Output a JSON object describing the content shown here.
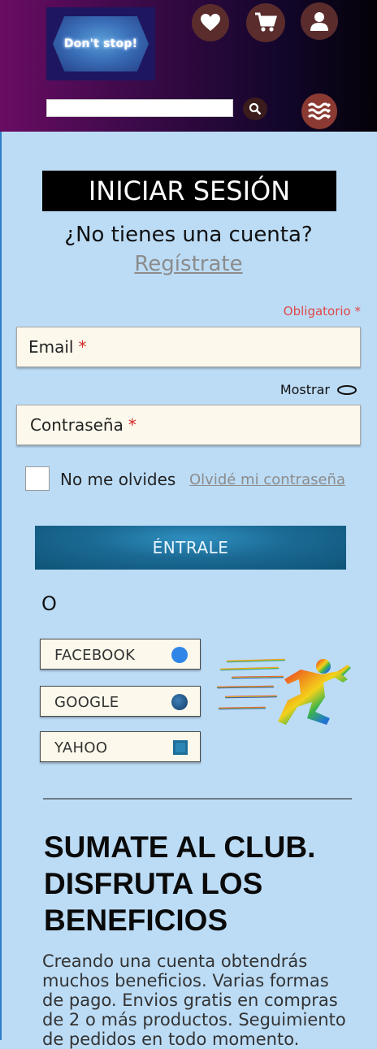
{
  "header": {
    "logo_text": "Don't stop!",
    "icons": [
      "heart-icon",
      "cart-icon",
      "user-icon"
    ],
    "search": {
      "value": "",
      "placeholder": ""
    },
    "search_icon": "search-icon",
    "menu_icon": "menu-icon"
  },
  "login": {
    "title": "INICIAR SESIÓN",
    "no_account": "¿No tienes una cuenta?",
    "register_link": "Regístrate",
    "required_note": "Obligatorio *",
    "email_label": "Email",
    "password_label": "Contraseña",
    "required_star": "*",
    "show_label": "Mostrar",
    "remember_label": "No me olvides",
    "forgot_link": "Olvidé mi contraseña",
    "submit_label": "ÉNTRALE",
    "or_text": "O"
  },
  "social": [
    {
      "label": "FACEBOOK",
      "icon": "circle-icon"
    },
    {
      "label": "GOOGLE",
      "icon": "circle-icon"
    },
    {
      "label": "YAHOO",
      "icon": "square-icon"
    }
  ],
  "club": {
    "heading_line1": "SUMATE AL CLUB.",
    "heading_line2": "DISFRUTA LOS",
    "heading_line3": "BENEFICIOS",
    "body": "Creando una cuenta obtendrás muchos beneficios. Varias formas de pago. Envios gratis en compras de 2 o más productos. Seguimiento de pedidos en todo momento."
  },
  "colors": {
    "page_bg": "#bcdcf6",
    "title_bg": "#000000",
    "submit_bg": "#1b6a94",
    "required": "#e04848",
    "link": "#8c8c8c",
    "field_bg": "#fcf9ec"
  }
}
